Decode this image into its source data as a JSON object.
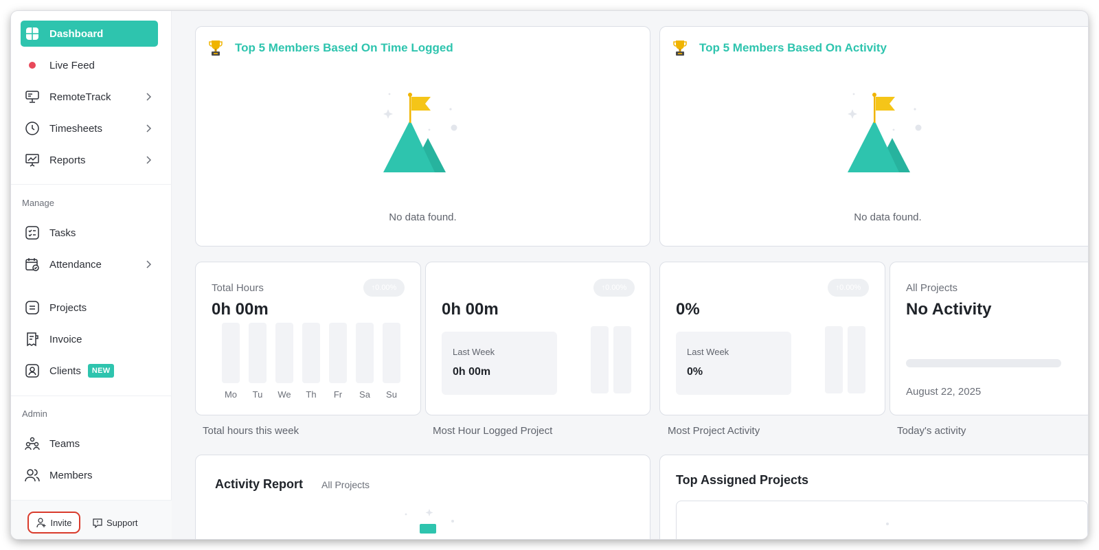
{
  "sidebar": {
    "items": [
      {
        "label": "Dashboard"
      },
      {
        "label": "Live Feed"
      },
      {
        "label": "RemoteTrack"
      },
      {
        "label": "Timesheets"
      },
      {
        "label": "Reports"
      }
    ],
    "manage_label": "Manage",
    "manage_items": [
      {
        "label": "Tasks"
      },
      {
        "label": "Attendance"
      },
      {
        "label": "Projects"
      },
      {
        "label": "Invoice"
      },
      {
        "label": "Clients",
        "badge": "NEW"
      }
    ],
    "admin_label": "Admin",
    "admin_items": [
      {
        "label": "Teams"
      },
      {
        "label": "Members"
      }
    ],
    "invite_label": "Invite",
    "support_label": "Support"
  },
  "top_cards": [
    {
      "title": "Top 5 Members Based On Time Logged",
      "empty_text": "No data found."
    },
    {
      "title": "Top 5 Members Based On Activity",
      "empty_text": "No data found."
    }
  ],
  "stats": {
    "total_hours": {
      "label": "Total Hours",
      "value": "0h 00m",
      "change": "↑0.00%",
      "days": [
        "Mo",
        "Tu",
        "We",
        "Th",
        "Fr",
        "Sa",
        "Su"
      ],
      "caption": "Total hours this week"
    },
    "most_hour_project": {
      "value": "0h 00m",
      "change": "↑0.00%",
      "last_week_label": "Last Week",
      "last_week_value": "0h 00m",
      "caption": "Most Hour Logged Project"
    },
    "most_project_activity": {
      "value": "0%",
      "change": "↑0.00%",
      "last_week_label": "Last Week",
      "last_week_value": "0%",
      "caption": "Most Project Activity"
    },
    "todays_activity": {
      "label": "All Projects",
      "value": "No Activity",
      "date": "August 22, 2025",
      "caption": "Today's activity"
    }
  },
  "activity_report": {
    "title": "Activity Report",
    "filter": "All Projects"
  },
  "top_assigned": {
    "title": "Top Assigned Projects"
  },
  "colors": {
    "accent": "#2ec4ae",
    "live_dot": "#e8495a",
    "flag": "#f5c518",
    "invite_outline": "#d93a2b"
  }
}
